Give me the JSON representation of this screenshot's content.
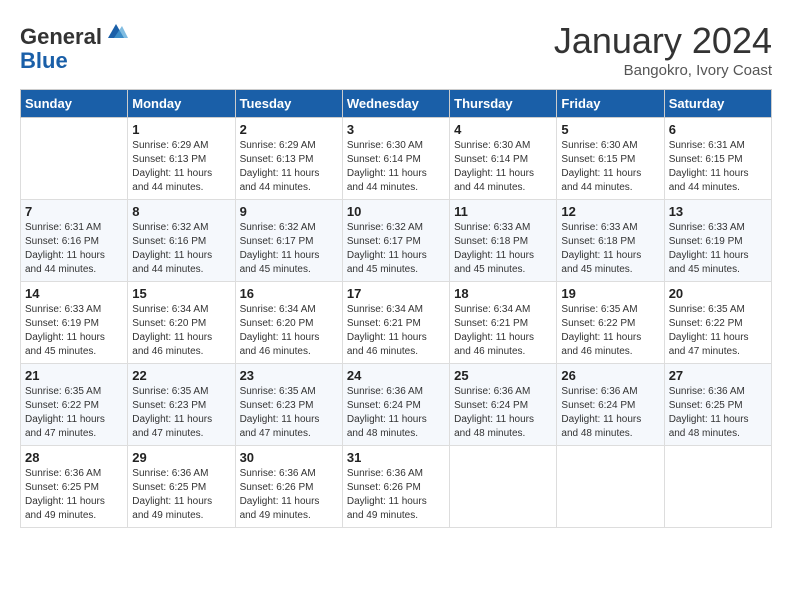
{
  "logo": {
    "general": "General",
    "blue": "Blue"
  },
  "header": {
    "month": "January 2024",
    "location": "Bangokro, Ivory Coast"
  },
  "weekdays": [
    "Sunday",
    "Monday",
    "Tuesday",
    "Wednesday",
    "Thursday",
    "Friday",
    "Saturday"
  ],
  "weeks": [
    [
      {
        "day": "",
        "sunrise": "",
        "sunset": "",
        "daylight": ""
      },
      {
        "day": "1",
        "sunrise": "Sunrise: 6:29 AM",
        "sunset": "Sunset: 6:13 PM",
        "daylight": "Daylight: 11 hours and 44 minutes."
      },
      {
        "day": "2",
        "sunrise": "Sunrise: 6:29 AM",
        "sunset": "Sunset: 6:13 PM",
        "daylight": "Daylight: 11 hours and 44 minutes."
      },
      {
        "day": "3",
        "sunrise": "Sunrise: 6:30 AM",
        "sunset": "Sunset: 6:14 PM",
        "daylight": "Daylight: 11 hours and 44 minutes."
      },
      {
        "day": "4",
        "sunrise": "Sunrise: 6:30 AM",
        "sunset": "Sunset: 6:14 PM",
        "daylight": "Daylight: 11 hours and 44 minutes."
      },
      {
        "day": "5",
        "sunrise": "Sunrise: 6:30 AM",
        "sunset": "Sunset: 6:15 PM",
        "daylight": "Daylight: 11 hours and 44 minutes."
      },
      {
        "day": "6",
        "sunrise": "Sunrise: 6:31 AM",
        "sunset": "Sunset: 6:15 PM",
        "daylight": "Daylight: 11 hours and 44 minutes."
      }
    ],
    [
      {
        "day": "7",
        "sunrise": "Sunrise: 6:31 AM",
        "sunset": "Sunset: 6:16 PM",
        "daylight": "Daylight: 11 hours and 44 minutes."
      },
      {
        "day": "8",
        "sunrise": "Sunrise: 6:32 AM",
        "sunset": "Sunset: 6:16 PM",
        "daylight": "Daylight: 11 hours and 44 minutes."
      },
      {
        "day": "9",
        "sunrise": "Sunrise: 6:32 AM",
        "sunset": "Sunset: 6:17 PM",
        "daylight": "Daylight: 11 hours and 45 minutes."
      },
      {
        "day": "10",
        "sunrise": "Sunrise: 6:32 AM",
        "sunset": "Sunset: 6:17 PM",
        "daylight": "Daylight: 11 hours and 45 minutes."
      },
      {
        "day": "11",
        "sunrise": "Sunrise: 6:33 AM",
        "sunset": "Sunset: 6:18 PM",
        "daylight": "Daylight: 11 hours and 45 minutes."
      },
      {
        "day": "12",
        "sunrise": "Sunrise: 6:33 AM",
        "sunset": "Sunset: 6:18 PM",
        "daylight": "Daylight: 11 hours and 45 minutes."
      },
      {
        "day": "13",
        "sunrise": "Sunrise: 6:33 AM",
        "sunset": "Sunset: 6:19 PM",
        "daylight": "Daylight: 11 hours and 45 minutes."
      }
    ],
    [
      {
        "day": "14",
        "sunrise": "Sunrise: 6:33 AM",
        "sunset": "Sunset: 6:19 PM",
        "daylight": "Daylight: 11 hours and 45 minutes."
      },
      {
        "day": "15",
        "sunrise": "Sunrise: 6:34 AM",
        "sunset": "Sunset: 6:20 PM",
        "daylight": "Daylight: 11 hours and 46 minutes."
      },
      {
        "day": "16",
        "sunrise": "Sunrise: 6:34 AM",
        "sunset": "Sunset: 6:20 PM",
        "daylight": "Daylight: 11 hours and 46 minutes."
      },
      {
        "day": "17",
        "sunrise": "Sunrise: 6:34 AM",
        "sunset": "Sunset: 6:21 PM",
        "daylight": "Daylight: 11 hours and 46 minutes."
      },
      {
        "day": "18",
        "sunrise": "Sunrise: 6:34 AM",
        "sunset": "Sunset: 6:21 PM",
        "daylight": "Daylight: 11 hours and 46 minutes."
      },
      {
        "day": "19",
        "sunrise": "Sunrise: 6:35 AM",
        "sunset": "Sunset: 6:22 PM",
        "daylight": "Daylight: 11 hours and 46 minutes."
      },
      {
        "day": "20",
        "sunrise": "Sunrise: 6:35 AM",
        "sunset": "Sunset: 6:22 PM",
        "daylight": "Daylight: 11 hours and 47 minutes."
      }
    ],
    [
      {
        "day": "21",
        "sunrise": "Sunrise: 6:35 AM",
        "sunset": "Sunset: 6:22 PM",
        "daylight": "Daylight: 11 hours and 47 minutes."
      },
      {
        "day": "22",
        "sunrise": "Sunrise: 6:35 AM",
        "sunset": "Sunset: 6:23 PM",
        "daylight": "Daylight: 11 hours and 47 minutes."
      },
      {
        "day": "23",
        "sunrise": "Sunrise: 6:35 AM",
        "sunset": "Sunset: 6:23 PM",
        "daylight": "Daylight: 11 hours and 47 minutes."
      },
      {
        "day": "24",
        "sunrise": "Sunrise: 6:36 AM",
        "sunset": "Sunset: 6:24 PM",
        "daylight": "Daylight: 11 hours and 48 minutes."
      },
      {
        "day": "25",
        "sunrise": "Sunrise: 6:36 AM",
        "sunset": "Sunset: 6:24 PM",
        "daylight": "Daylight: 11 hours and 48 minutes."
      },
      {
        "day": "26",
        "sunrise": "Sunrise: 6:36 AM",
        "sunset": "Sunset: 6:24 PM",
        "daylight": "Daylight: 11 hours and 48 minutes."
      },
      {
        "day": "27",
        "sunrise": "Sunrise: 6:36 AM",
        "sunset": "Sunset: 6:25 PM",
        "daylight": "Daylight: 11 hours and 48 minutes."
      }
    ],
    [
      {
        "day": "28",
        "sunrise": "Sunrise: 6:36 AM",
        "sunset": "Sunset: 6:25 PM",
        "daylight": "Daylight: 11 hours and 49 minutes."
      },
      {
        "day": "29",
        "sunrise": "Sunrise: 6:36 AM",
        "sunset": "Sunset: 6:25 PM",
        "daylight": "Daylight: 11 hours and 49 minutes."
      },
      {
        "day": "30",
        "sunrise": "Sunrise: 6:36 AM",
        "sunset": "Sunset: 6:26 PM",
        "daylight": "Daylight: 11 hours and 49 minutes."
      },
      {
        "day": "31",
        "sunrise": "Sunrise: 6:36 AM",
        "sunset": "Sunset: 6:26 PM",
        "daylight": "Daylight: 11 hours and 49 minutes."
      },
      {
        "day": "",
        "sunrise": "",
        "sunset": "",
        "daylight": ""
      },
      {
        "day": "",
        "sunrise": "",
        "sunset": "",
        "daylight": ""
      },
      {
        "day": "",
        "sunrise": "",
        "sunset": "",
        "daylight": ""
      }
    ]
  ]
}
